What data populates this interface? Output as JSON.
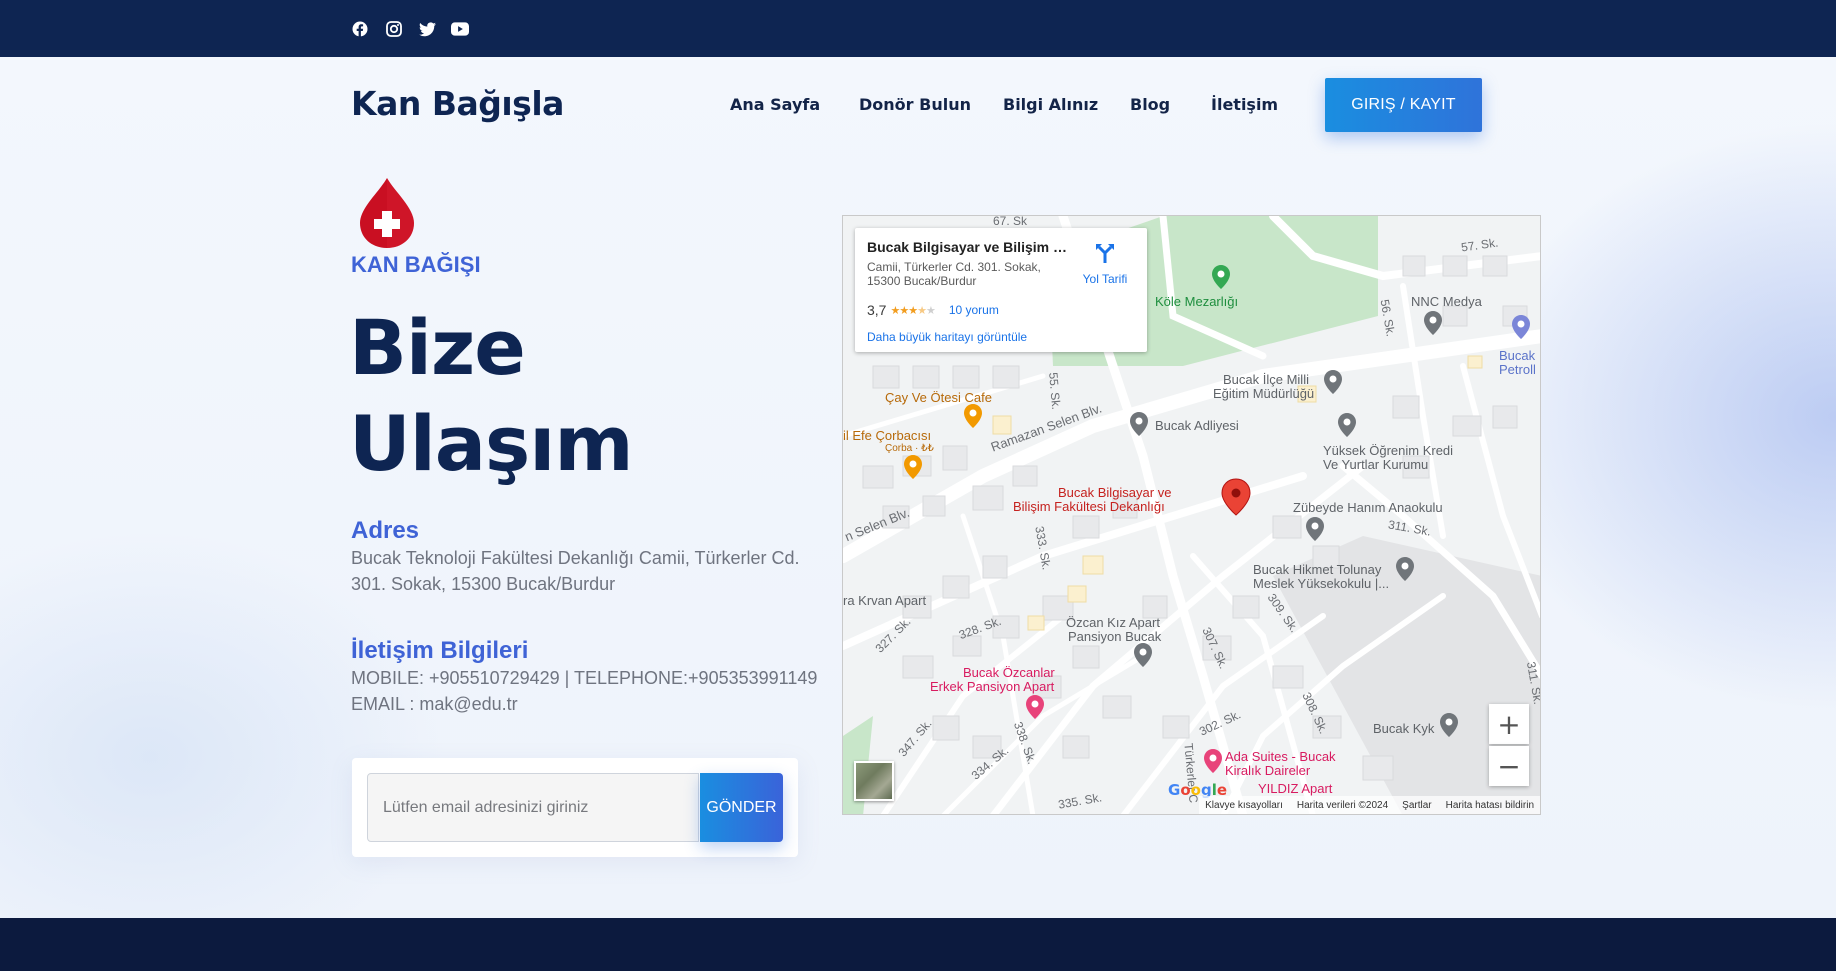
{
  "topbar": {
    "social": [
      "facebook-icon",
      "instagram-icon",
      "twitter-icon",
      "youtube-icon"
    ]
  },
  "header": {
    "brand": "Kan Bağışla",
    "nav": [
      "Ana Sayfa",
      "Donör Bulun",
      "Bilgi Alınız",
      "Blog",
      "İletişim"
    ],
    "login_label": "GIRIŞ / KAYIT"
  },
  "hero": {
    "icon": "blood-drop-cross-icon",
    "kicker": "KAN BAĞIŞI",
    "title_line1": "Bize",
    "title_line2": "Ulaşım"
  },
  "address": {
    "heading": "Adres",
    "line1": "Bucak Teknoloji Fakültesi Dekanlığı Camii, Türkerler Cd.",
    "line2": "301. Sokak, 15300 Bucak/Burdur"
  },
  "contact": {
    "heading": "İletişim Bilgileri",
    "line1": "MOBILE: +905510729429 | TELEPHONE:+905353991149",
    "line2": "EMAIL : mak@edu.tr"
  },
  "newsletter": {
    "placeholder": "Lütfen email adresinizi giriniz",
    "button": "GÖNDER"
  },
  "map": {
    "card": {
      "title": "Bucak Bilgisayar ve Bilişim Fa...",
      "address": "Camii, Türkerler Cd. 301. Sokak, 15300 Bucak/Burdur",
      "rating": "3,7",
      "stars": 3.5,
      "reviews": "10 yorum",
      "bigger_map": "Daha büyük haritayı görüntüle",
      "directions": "Yol Tarifi"
    },
    "labels": {
      "sk67": "67. Sk",
      "sk57": "57. Sk.",
      "kole": "Köle Mezarlığı",
      "nnc": "NNC Medya",
      "sk56": "56. Sk.",
      "bucak_petrol_1": "Bucak",
      "bucak_petrol_2": "Petroll",
      "milli_egitim_1": "Bucak İlçe Milli",
      "milli_egitim_2": "Eğitim Müdürlüğü",
      "sk55": "55. Sk.",
      "cay": "Çay Ve Ötesi Cafe",
      "adliye": "Bucak Adliyesi",
      "ramazan": "Ramazan Selen Blv.",
      "efe_1": "il Efe Çorbacısı",
      "efe_2": "Çorba · ₺₺",
      "yurt_1": "Yüksek Öğrenim Kredi",
      "yurt_2": "Ve Yurtlar Kurumu",
      "faculty_1": "Bucak Bilgisayar ve",
      "faculty_2": "Bilişim Fakültesi Dekanlığı",
      "selen": "n Selen Blv.",
      "anaokulu": "Zübeyde Hanım Anaokulu",
      "sk311a": "311. Sk.",
      "sk333": "333. Sk.",
      "hikmet_1": "Bucak Hikmet Tolunay",
      "hikmet_2": "Meslek Yüksekokulu |...",
      "krvan": "ra Krvan Apart",
      "sk309": "309. Sk.",
      "sk327": "327. Sk.",
      "sk328": "328. Sk.",
      "ozcan_kiz_1": "Özcan Kız Apart",
      "ozcan_kiz_2": "Pansiyon Bucak",
      "sk307": "307. Sk.",
      "ozcanlar_1": "Bucak Özcanlar",
      "ozcanlar_2": "Erkek Pansiyon Apart",
      "sk311b": "311. Sk.",
      "sk308": "308. Sk.",
      "kyk": "Bucak Kyk",
      "sk302": "302. Sk.",
      "sk347": "347. Sk.",
      "sk338": "338. Sk.",
      "sk334": "334. Sk.",
      "turkerler": "Türkerler C",
      "ada_1": "Ada Suites - Bucak",
      "ada_2": "Kiralık Daireler",
      "yildiz": "YILDIZ Apart",
      "sk335": "335. Sk."
    },
    "google": "Google",
    "footer": [
      "Klavye kısayolları",
      "Harita verileri ©2024",
      "Şartlar",
      "Harita hatası bildirin"
    ],
    "zoom_in": "+",
    "zoom_out": "−"
  }
}
